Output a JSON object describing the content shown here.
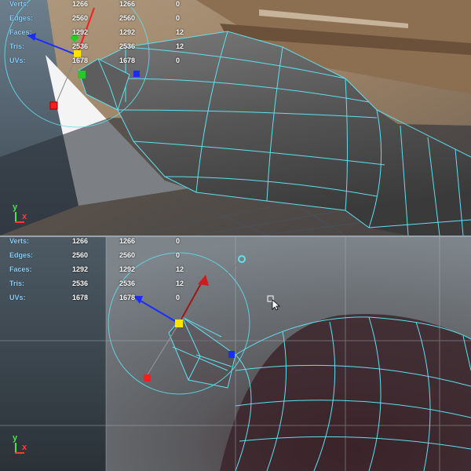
{
  "stats": {
    "rows": [
      {
        "label": "Verts:",
        "values": [
          "1266",
          "1266",
          "0"
        ]
      },
      {
        "label": "Edges:",
        "values": [
          "2560",
          "2560",
          "0"
        ]
      },
      {
        "label": "Faces:",
        "values": [
          "1292",
          "1292",
          "12"
        ]
      },
      {
        "label": "Tris:",
        "values": [
          "2536",
          "2536",
          "12"
        ]
      },
      {
        "label": "UVs:",
        "values": [
          "1678",
          "1678",
          "0"
        ]
      }
    ]
  },
  "axis": {
    "y": "y",
    "x": "x"
  },
  "colors": {
    "wireframe": "#5ee0f0",
    "manip_x": "#ff1c1c",
    "manip_y": "#22cc22",
    "manip_z": "#1a2cff",
    "manip_center": "#ffe400",
    "stat_label": "#8fd4ff"
  }
}
